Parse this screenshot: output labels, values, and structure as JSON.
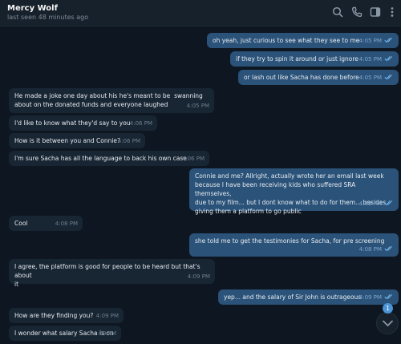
{
  "header": {
    "contact_name": "Mercy Wolf",
    "last_seen": "last seen 48 minutes ago",
    "icons": [
      "search-icon",
      "phone-icon",
      "sidebar-toggle-icon",
      "more-vert-icon"
    ]
  },
  "colors": {
    "background": "#0e1621",
    "header": "#17212b",
    "incoming_bubble": "#182533",
    "outgoing_bubble": "#2b5278",
    "read_ticks": "#6fb1e8",
    "badge": "#4a94d6"
  },
  "messages": [
    {
      "direction": "out",
      "text": "oh yeah, just curious to see what they see to me",
      "time": "4:05 PM",
      "read": true
    },
    {
      "direction": "out",
      "text": "if they try to spin it around or just ignore",
      "time": "4:05 PM",
      "read": true
    },
    {
      "direction": "out",
      "text": "or lash out like Sacha has done before",
      "time": "4:05 PM",
      "read": true
    },
    {
      "direction": "in",
      "text": "He made a joke one day about his he's meant to be  swanning\nabout on the donated funds and everyone laughed",
      "time": "4:05 PM"
    },
    {
      "direction": "in",
      "text": "I'd like to know what they'd say to you",
      "time": "4:06 PM"
    },
    {
      "direction": "in",
      "text": "How is it between you and Connie?",
      "time": "4:06 PM"
    },
    {
      "direction": "in",
      "text": "I'm sure Sacha has all the language to back his own case",
      "time": "4:06 PM"
    },
    {
      "direction": "out",
      "text": "Connie and me? Allright, actually wrote her an email last week\nbecause I have been receiving kids who suffered SRA themselves,\ndue to my film... but I dont know what to do for them... besides\ngiving them a platform to go public",
      "time": "4:08 PM",
      "read": true
    },
    {
      "direction": "in",
      "text": "Cool",
      "time": "4:08 PM"
    },
    {
      "direction": "out",
      "text": "she told me to get the testimonies for Sacha, for pre screening",
      "time": "4:08 PM",
      "read": true
    },
    {
      "direction": "in",
      "text": "I agree, the platform is good for people to be heard but that's about\nit",
      "time": "4:09 PM"
    },
    {
      "direction": "out",
      "text": "yep... and the salary of Sir John is outrageous",
      "time": "4:09 PM",
      "read": true
    },
    {
      "direction": "in",
      "text": "How are they finding you?",
      "time": "4:09 PM"
    },
    {
      "direction": "in",
      "text": "I wonder what salary Sacha is on",
      "time": "4:09 PM"
    }
  ],
  "scroll_down": {
    "unread_count": "1",
    "icon": "chevron-down-icon"
  }
}
